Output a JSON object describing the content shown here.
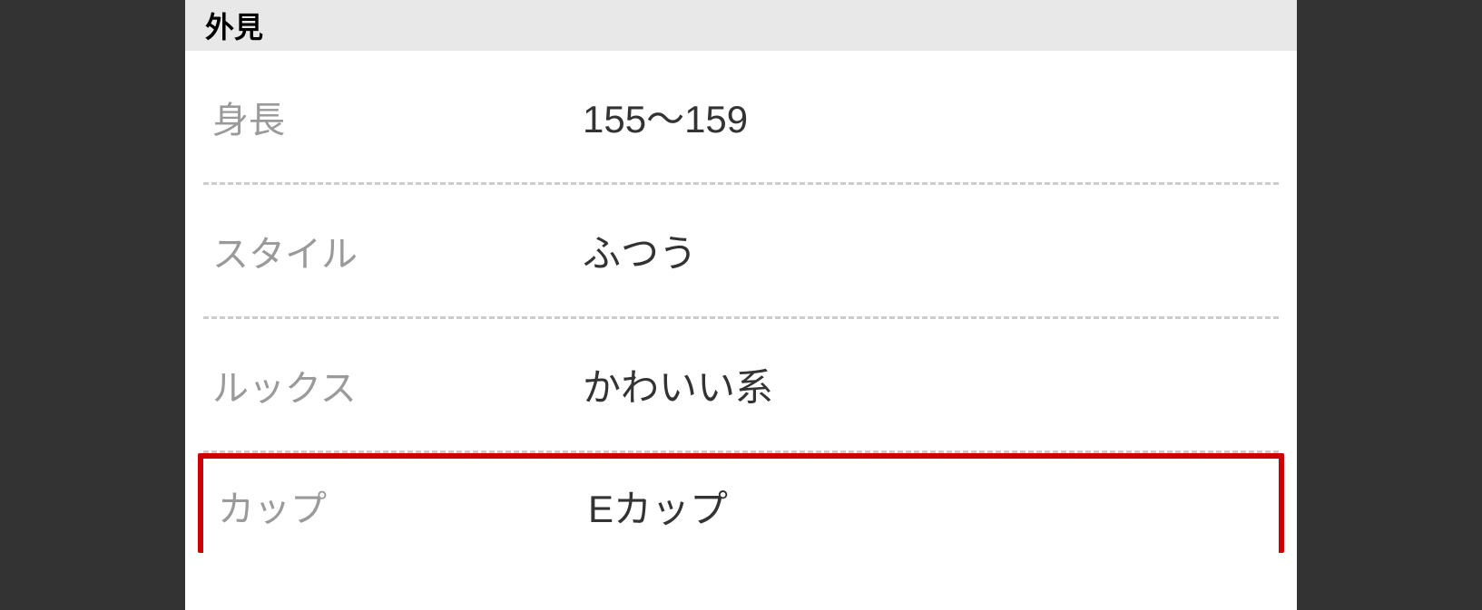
{
  "section": {
    "title": "外見",
    "rows": [
      {
        "label": "身長",
        "value": "155〜159"
      },
      {
        "label": "スタイル",
        "value": "ふつう"
      },
      {
        "label": "ルックス",
        "value": "かわいい系"
      },
      {
        "label": "カップ",
        "value": "Eカップ"
      }
    ]
  }
}
